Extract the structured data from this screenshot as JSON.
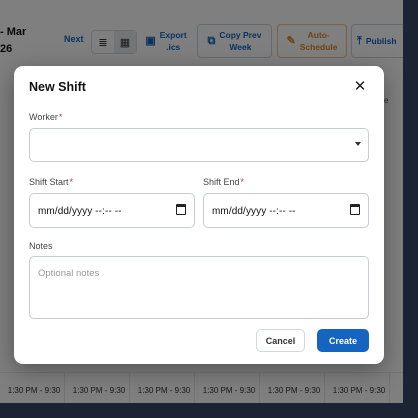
{
  "toolbar": {
    "range_line1": "- Mar",
    "range_line2": "26",
    "next_label": "Next",
    "list_icon": "≣",
    "grid_icon": "▦",
    "export_label_1": "Export",
    "export_label_2": ".ics",
    "copy_label_1": "Copy Prev",
    "copy_label_2": "Week",
    "auto_label_1": "Auto-",
    "auto_label_2": "Schedule",
    "publish_label": "Publish",
    "truncated_text": "e"
  },
  "grid": {
    "cells": [
      "1:30 PM - 9:30",
      "1:30 PM - 9:30",
      "1:30 PM - 9:30",
      "1:30 PM - 9:30",
      "1:30 PM - 9:30",
      "1:30 PM - 9:30"
    ]
  },
  "modal": {
    "title": "New Shift",
    "close_glyph": "✕",
    "worker_label": "Worker",
    "required_mark": "*",
    "worker_value": "",
    "shift_start_label": "Shift Start",
    "shift_start_value": "mm/dd/yyyy --:-- --",
    "shift_end_label": "Shift End",
    "shift_end_value": "mm/dd/yyyy --:-- --",
    "notes_label": "Notes",
    "notes_placeholder": "Optional notes",
    "cancel_label": "Cancel",
    "create_label": "Create"
  },
  "colors": {
    "primary": "#1565c0",
    "auto_schedule": "#e08a1e",
    "required": "#d32f2f"
  }
}
